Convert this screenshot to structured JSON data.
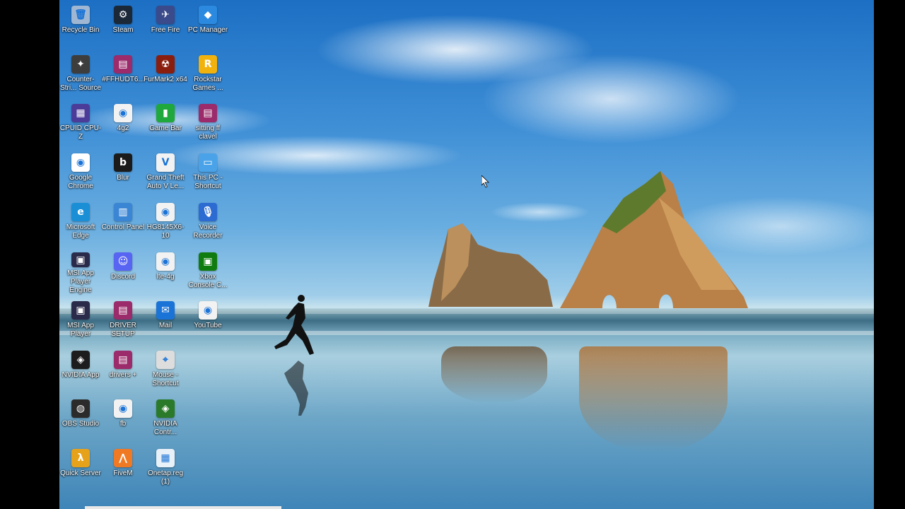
{
  "desktop": {
    "icons": [
      {
        "label": "Recycle Bin",
        "icon": "recycle-bin-icon",
        "color": "#9fb7d2",
        "glyph": "🗑"
      },
      {
        "label": "Counter-Stri... Source",
        "icon": "counter-strike-icon",
        "color": "#3d3d3d",
        "glyph": "✦"
      },
      {
        "label": "CPUID CPU-Z",
        "icon": "cpuz-icon",
        "color": "#4b3c9a",
        "glyph": "▦"
      },
      {
        "label": "Google Chrome",
        "icon": "chrome-icon",
        "color": "#ffffff",
        "glyph": "◉"
      },
      {
        "label": "Microsoft Edge",
        "icon": "edge-icon",
        "color": "#1a8fd6",
        "glyph": "e"
      },
      {
        "label": "MSI App Player Engine",
        "icon": "msi-app-player-icon",
        "color": "#2a2a4a",
        "glyph": "▣"
      },
      {
        "label": "MSI App Player",
        "icon": "msi-app-player-icon",
        "color": "#2a2a4a",
        "glyph": "▣"
      },
      {
        "label": "NVIDIA App",
        "icon": "nvidia-icon",
        "color": "#1d1d1d",
        "glyph": "◈"
      },
      {
        "label": "OBS Studio",
        "icon": "obs-icon",
        "color": "#2b2b2b",
        "glyph": "◍"
      },
      {
        "label": "Quick Server",
        "icon": "half-life-icon",
        "color": "#e7a21c",
        "glyph": "λ"
      },
      {
        "label": "Steam",
        "icon": "steam-icon",
        "color": "#1b2838",
        "glyph": "⚙"
      },
      {
        "label": "#FFHUDT6...",
        "icon": "winrar-icon",
        "color": "#9b2b6a",
        "glyph": "▤"
      },
      {
        "label": "4g2",
        "icon": "chrome-file-icon",
        "color": "#f2f2f2",
        "glyph": "◉"
      },
      {
        "label": "Blur",
        "icon": "blur-icon",
        "color": "#1b1b1b",
        "glyph": "b"
      },
      {
        "label": "Control Panel",
        "icon": "control-panel-icon",
        "color": "#3a86d4",
        "glyph": "▥"
      },
      {
        "label": "Discord",
        "icon": "discord-icon",
        "color": "#5865f2",
        "glyph": "☺"
      },
      {
        "label": "DRIVER SETUP",
        "icon": "winrar-icon",
        "color": "#9b2b6a",
        "glyph": "▤"
      },
      {
        "label": "drivers +",
        "icon": "winrar-icon",
        "color": "#9b2b6a",
        "glyph": "▤"
      },
      {
        "label": "fb",
        "icon": "chrome-file-icon",
        "color": "#f2f2f2",
        "glyph": "◉"
      },
      {
        "label": "FiveM",
        "icon": "fivem-icon",
        "color": "#f07a24",
        "glyph": "⋀"
      },
      {
        "label": "Free Fire",
        "icon": "free-fire-icon",
        "color": "#3a4a8a",
        "glyph": "✈"
      },
      {
        "label": "FurMark2 x64",
        "icon": "furmark-icon",
        "color": "#8a1e0e",
        "glyph": "☢"
      },
      {
        "label": "Game Bar",
        "icon": "game-bar-icon",
        "color": "#1fa83c",
        "glyph": "▮"
      },
      {
        "label": "Grand Theft Auto V Le...",
        "icon": "gta-icon",
        "color": "#f2f2f2",
        "glyph": "V"
      },
      {
        "label": "HG8145X6-10",
        "icon": "chrome-file-icon",
        "color": "#f2f2f2",
        "glyph": "◉"
      },
      {
        "label": "lte-4g",
        "icon": "chrome-file-icon",
        "color": "#f2f2f2",
        "glyph": "◉"
      },
      {
        "label": "Mail",
        "icon": "mail-icon",
        "color": "#1a73d6",
        "glyph": "✉"
      },
      {
        "label": "Mouse - Shortcut",
        "icon": "mouse-icon",
        "color": "#dddddd",
        "glyph": "⌖"
      },
      {
        "label": "NVIDIA Contr...",
        "icon": "nvidia-control-icon",
        "color": "#2a7a2a",
        "glyph": "◈"
      },
      {
        "label": "Onetap.reg (1)",
        "icon": "registry-file-icon",
        "color": "#e8f0f8",
        "glyph": "▦"
      },
      {
        "label": "PC Manager",
        "icon": "pc-manager-icon",
        "color": "#2b8adf",
        "glyph": "◆"
      },
      {
        "label": "Rockstar Games ...",
        "icon": "rockstar-icon",
        "color": "#f2b20e",
        "glyph": "R"
      },
      {
        "label": "sitting ff clavel",
        "icon": "winrar-icon",
        "color": "#9b2b6a",
        "glyph": "▤"
      },
      {
        "label": "This PC - Shortcut",
        "icon": "this-pc-icon",
        "color": "#4aa3e8",
        "glyph": "▭"
      },
      {
        "label": "Voice Recorder",
        "icon": "voice-recorder-icon",
        "color": "#2c6bd1",
        "glyph": "🎙"
      },
      {
        "label": "Xbox Console C...",
        "icon": "xbox-icon",
        "color": "#107c10",
        "glyph": "▣"
      },
      {
        "label": "YouTube",
        "icon": "chrome-file-icon",
        "color": "#f2f2f2",
        "glyph": "◉"
      }
    ]
  }
}
